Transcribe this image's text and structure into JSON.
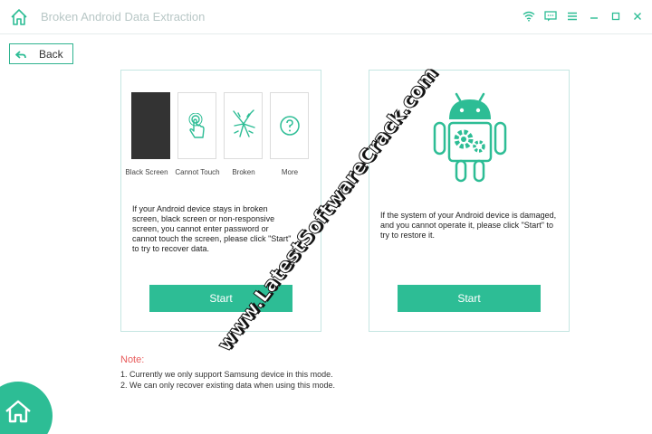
{
  "window": {
    "title": "Broken Android Data Extraction"
  },
  "nav": {
    "back_label": "Back"
  },
  "left_card": {
    "options": [
      {
        "label": "Black Screen",
        "icon": "black-screen-icon"
      },
      {
        "label": "Cannot Touch",
        "icon": "touch-hand-icon"
      },
      {
        "label": "Broken",
        "icon": "cracked-screen-icon"
      },
      {
        "label": "More",
        "icon": "question-icon"
      }
    ],
    "description": "If your Android device stays in broken screen, black screen or non-responsive screen, you cannot enter password or cannot touch the screen, please click \"Start\" to try to recover data.",
    "start_label": "Start"
  },
  "right_card": {
    "icon": "android-gear-icon",
    "description": "If the system of your Android device is damaged, and you cannot operate it, please click \"Start\" to try to restore it.",
    "start_label": "Start"
  },
  "notes": {
    "title": "Note:",
    "items": [
      "1. Currently we only support Samsung device in this mode.",
      "2. We can only recover existing data when using this mode."
    ]
  },
  "watermark": {
    "text": "www.LatestSoftwareCrack.com"
  },
  "colors": {
    "accent": "#2dbd95",
    "note": "#e85c5c",
    "title": "#b8c7c6"
  }
}
